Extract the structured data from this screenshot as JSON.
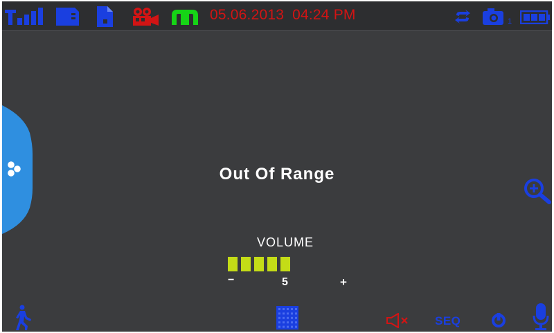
{
  "status_bar": {
    "icons": [
      "signal-icon",
      "sd-card-icon",
      "file-icon",
      "video-recording-icon",
      "motion-detection-icon",
      "loop-record-icon",
      "camera-icon",
      "battery-icon"
    ],
    "date": "05.06.2013",
    "time": "04:24 PM",
    "camera_index": "1",
    "colors": {
      "blue": "#1a3fe0",
      "red": "#d21414",
      "green": "#16d416"
    }
  },
  "main": {
    "message": "Out Of Range"
  },
  "volume": {
    "title": "VOLUME",
    "minus": "−",
    "plus": "+",
    "value": "5",
    "level": 5,
    "max_bars": 5,
    "bar_color": "#c4dc17"
  },
  "side_tab": {
    "icon": "menu-dots-icon",
    "color": "#2f8fe0"
  },
  "bottom_bar": {
    "icons": [
      "walking-person-icon",
      "grid-layout-icon",
      "mute-speaker-icon",
      "seq-label",
      "power-icon",
      "microphone-icon"
    ],
    "seq_label": "SEQ"
  }
}
